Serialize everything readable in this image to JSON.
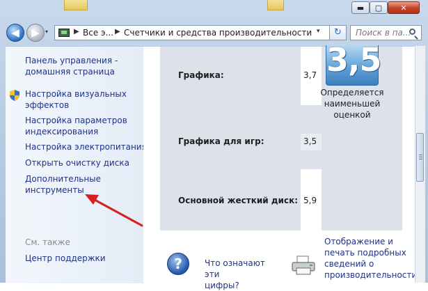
{
  "window": {
    "min_glyph": "▬",
    "max_glyph": "▢",
    "close_glyph": "✕"
  },
  "nav": {
    "back_glyph": "◀",
    "forward_glyph": "▶",
    "dropdown_glyph": "▾"
  },
  "address": {
    "segment1": "Все э...",
    "segment2": "Счетчики и средства производительности",
    "sep_glyph": "▶",
    "dropdown_glyph": "▾",
    "refresh_glyph": "↻"
  },
  "search": {
    "placeholder": "Поиск в па..."
  },
  "sidebar": {
    "home_line1": "Панель управления -",
    "home_line2": "домашняя страница",
    "links": [
      {
        "line1": "Настройка визуальных",
        "line2": "эффектов"
      },
      {
        "line1": "Настройка параметров",
        "line2": "индексирования"
      },
      {
        "line1": "Настройка электропитания",
        "line2": ""
      },
      {
        "line1": "Открыть очистку диска",
        "line2": ""
      },
      {
        "line1": "Дополнительные",
        "line2": "инструменты"
      }
    ],
    "see_also": "См. также",
    "support": "Центр поддержки"
  },
  "main": {
    "rows": [
      {
        "label": "Графика:",
        "value": "3,7"
      },
      {
        "label": "Графика для игр:",
        "value": "3,5"
      },
      {
        "label": "Основной жесткий диск:",
        "value": "5,9"
      }
    ],
    "base_score": "3,5",
    "caption_line1": "Определяется",
    "caption_line2": "наименьшей",
    "caption_line3": "оценкой",
    "help_line1": "Что означают эти",
    "help_line2": "цифры?",
    "help_glyph": "?",
    "print_line1": "Отображение и",
    "print_line2": "печать подробных",
    "print_line3": "сведений о",
    "print_line4": "производительности"
  },
  "colors": {
    "link": "#1e3287",
    "arrow": "#d42020"
  }
}
